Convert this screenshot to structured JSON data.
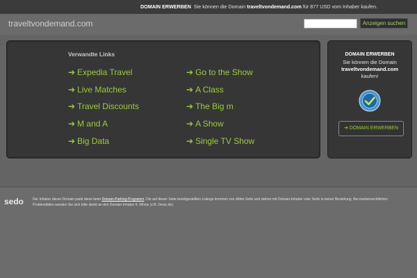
{
  "topbar": {
    "prefix": "DOMAIN ERWERBEN",
    "text_before": "Sie können die Domain",
    "domain": "traveltvondemand.com",
    "text_after": "für 877 USD vom Inhaber kaufen."
  },
  "header": {
    "site_name": "traveltvondemand.com",
    "search_value": "",
    "search_button": "Anzeigen suchen"
  },
  "links": {
    "heading": "Verwandte Links",
    "arrow": "➔",
    "left": [
      "Expedia Travel",
      "Live Matches",
      "Travel Discounts",
      "M and A",
      "Big Data"
    ],
    "right": [
      "Go to the Show",
      "A Class",
      "The Big m",
      "A Show",
      "Single TV Show"
    ]
  },
  "side": {
    "title": "DOMAIN ERWERBEN",
    "text1": "Sie können die Domain",
    "domain": "traveltvondemand.com",
    "text2": "kaufen!",
    "badge_icon": "seal-badge-icon",
    "button_label": "DOMAIN ERWERBEN",
    "button_icon": "arrow-right-icon"
  },
  "footer": {
    "logo": "sedo",
    "text_1": "Der Inhaber dieser Domain parkt diese beim",
    "link": "Domain-Parking-Programm",
    "text_2": ". Die auf dieser Seite bereitgestellten Listings kommen von dritter Seite und stehen mit Domain-Inhaber oder Sedo in keiner Beziehung. Bei markenrechtlichen Problemfällen wenden Sie sich bitte direkt an den Domain-Inhaber lt. Whois (z.B. Denic.de)."
  },
  "colors": {
    "accent_green": "#9ccb3f",
    "panel_bg": "#363636",
    "page_bg": "#646464"
  }
}
